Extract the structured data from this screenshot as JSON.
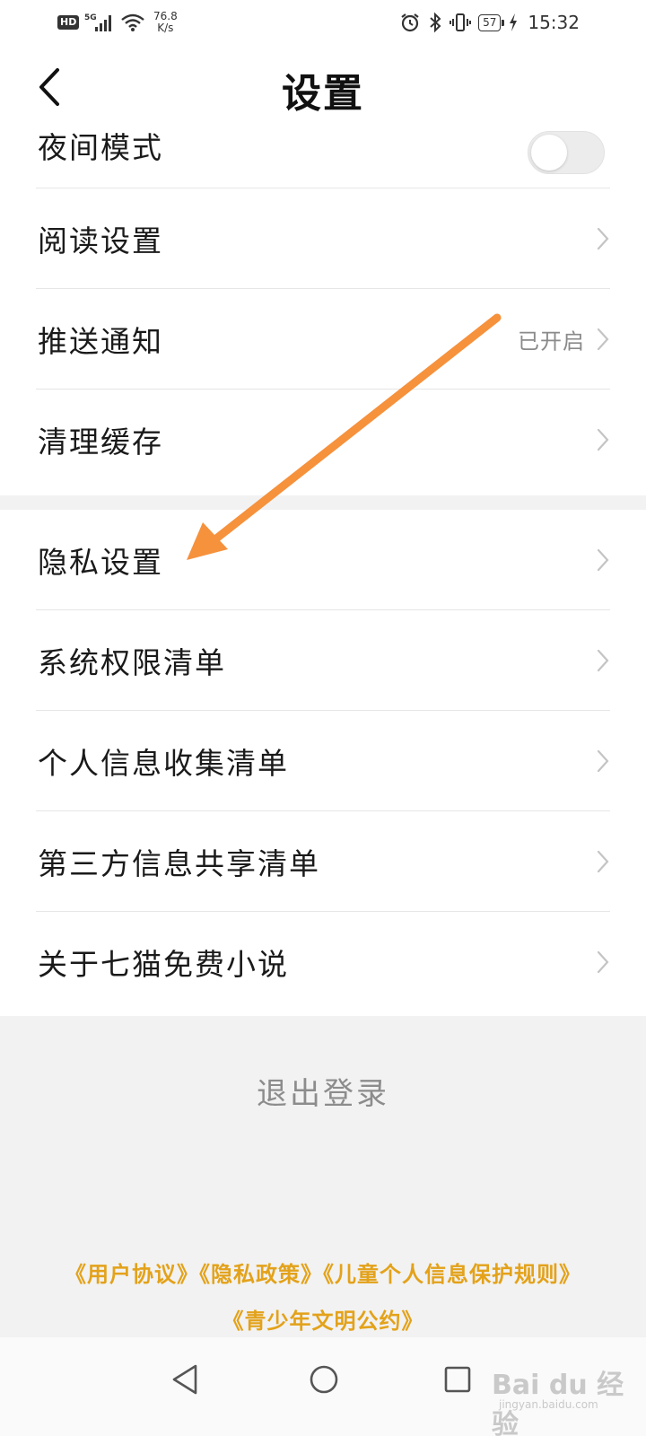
{
  "status_bar": {
    "hd": "HD",
    "net_speed_value": "76.8",
    "net_speed_unit": "K/s",
    "battery": "57",
    "time": "15:32",
    "icons": [
      "signal-5g-icon",
      "wifi-icon",
      "alarm-icon",
      "bluetooth-icon",
      "vibrate-icon",
      "battery-icon",
      "charging-icon"
    ]
  },
  "header": {
    "title": "设置",
    "back_icon": "chevron-left-icon"
  },
  "group1": {
    "items": [
      {
        "label": "夜间模式",
        "control": "toggle",
        "toggle_on": false
      },
      {
        "label": "阅读设置"
      },
      {
        "label": "推送通知",
        "value": "已开启"
      },
      {
        "label": "清理缓存"
      }
    ]
  },
  "group2": {
    "items": [
      {
        "label": "隐私设置"
      },
      {
        "label": "系统权限清单"
      },
      {
        "label": "个人信息收集清单"
      },
      {
        "label": "第三方信息共享清单"
      },
      {
        "label": "关于七猫免费小说"
      }
    ]
  },
  "logout": {
    "label": "退出登录"
  },
  "footer": {
    "links": [
      "《用户协议》",
      "《隐私政策》",
      "《儿童个人信息保护规则》",
      "《青少年文明公约》"
    ]
  },
  "nav_bar": {
    "icons": [
      "nav-back-icon",
      "nav-home-icon",
      "nav-recents-icon"
    ]
  },
  "watermark": {
    "brand": "Bai du 经验",
    "url": "jingyan.baidu.com"
  },
  "colors": {
    "accent": "#e3a21a",
    "arrow": "#f6913c",
    "background": "#f2f2f2",
    "card": "#ffffff"
  }
}
